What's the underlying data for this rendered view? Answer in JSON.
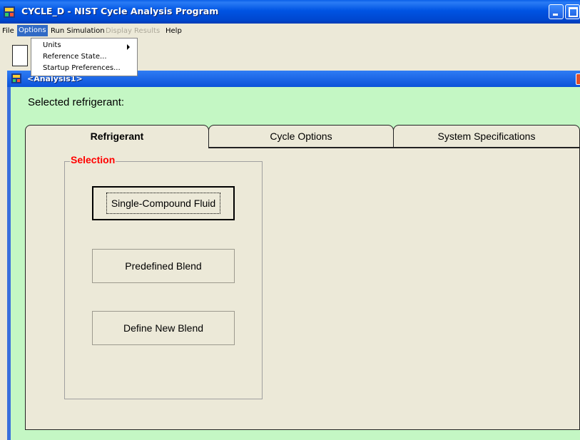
{
  "window": {
    "title": "CYCLE_D - NIST Cycle Analysis Program"
  },
  "menubar": {
    "items": [
      {
        "label": "File",
        "state": "normal"
      },
      {
        "label": "Options",
        "state": "active"
      },
      {
        "label": "Run Simulation",
        "state": "normal"
      },
      {
        "label": "Display Results",
        "state": "disabled"
      },
      {
        "label": "Help",
        "state": "normal"
      }
    ]
  },
  "options_menu": {
    "items": [
      {
        "label": "Units",
        "has_submenu": true
      },
      {
        "label": "Reference State..."
      },
      {
        "label": "Startup Preferences..."
      }
    ]
  },
  "child_window": {
    "title": "<Analysis1>"
  },
  "main": {
    "selected_refrigerant_label": "Selected refrigerant:",
    "tabs": [
      {
        "label": "Refrigerant",
        "selected": true
      },
      {
        "label": "Cycle Options",
        "selected": false
      },
      {
        "label": "System Specifications",
        "selected": false
      }
    ],
    "selection_group": {
      "label": "Selection",
      "buttons": [
        {
          "label": "Single-Compound Fluid",
          "focused": true
        },
        {
          "label": "Predefined Blend",
          "focused": false
        },
        {
          "label": "Define New Blend",
          "focused": false
        }
      ]
    }
  },
  "colors": {
    "titlebar": "#0054e3",
    "menu_highlight": "#316ac5",
    "form_background": "#c4f7c4",
    "group_label": "#ff0000",
    "panel": "#ece9d8"
  },
  "icons": {
    "app": "app-icon",
    "child": "child-window-icon",
    "minimize": "minimize-icon",
    "maximize": "maximize-icon",
    "close": "close-icon",
    "submenu": "submenu-arrow-icon"
  }
}
